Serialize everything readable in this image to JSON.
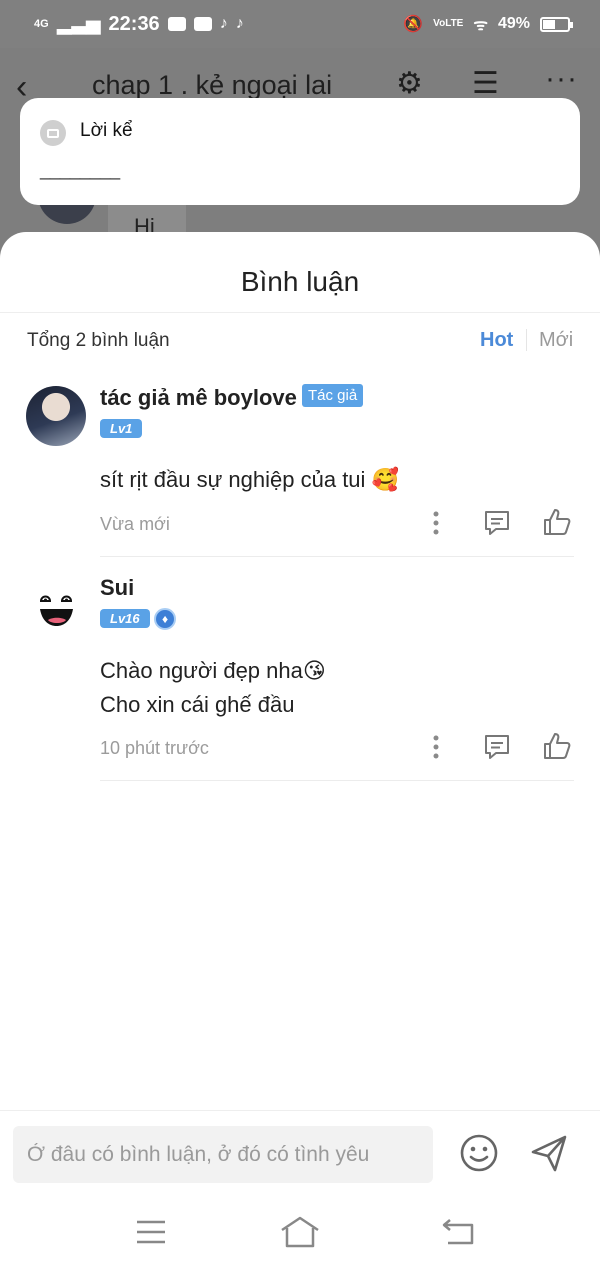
{
  "status_bar": {
    "network": "4G",
    "time": "22:36",
    "volte": "VoLTE",
    "battery": "49%"
  },
  "app_header": {
    "title": "chap 1 . kẻ ngoại lai"
  },
  "background_chat": {
    "message": "Hi"
  },
  "narration": {
    "title": "Lời kể",
    "body": "________"
  },
  "comments_sheet": {
    "title": "Bình luận",
    "total": "Tổng 2 bình luận",
    "sort_hot": "Hot",
    "sort_new": "Mới",
    "accent_color": "#4c8ad8",
    "comments": [
      {
        "user": "tác giả mê boylove",
        "author_badge": "Tác giả",
        "level": "Lv1",
        "text_lines": [
          "sít rịt đầu sự nghiệp của tui 🥰"
        ],
        "time": "Vừa mới"
      },
      {
        "user": "Sui",
        "level": "Lv16",
        "text_lines": [
          "Chào người đẹp nha😘",
          "Cho xin cái ghế đầu"
        ],
        "time": "10 phút trước"
      }
    ]
  },
  "input_bar": {
    "placeholder": "Ở đâu có bình luận, ở đó có tình yêu"
  }
}
